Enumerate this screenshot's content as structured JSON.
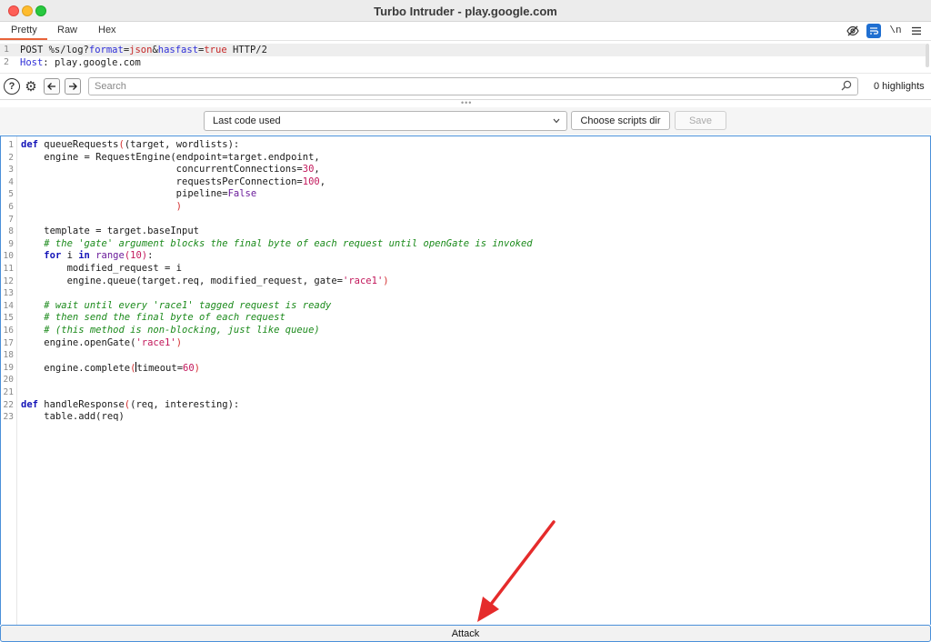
{
  "window": {
    "title": "Turbo Intruder - play.google.com"
  },
  "tabs": [
    {
      "label": "Pretty",
      "active": true
    },
    {
      "label": "Raw",
      "active": false
    },
    {
      "label": "Hex",
      "active": false
    }
  ],
  "toolbar_icons": {
    "hide": "eye-slash-icon",
    "wrap": "wrap-lines-icon",
    "newline_label": "\\n",
    "menu": "hamburger-menu-icon"
  },
  "request_preview": {
    "lines": [
      {
        "num": "1",
        "method": "POST ",
        "path": "%s/log?",
        "p1_key": "format",
        "p1_eq": "=",
        "p1_val": "json",
        "amp": "&",
        "p2_key": "hasfast",
        "p2_eq": "=",
        "p2_val": "true",
        "proto": " HTTP/2"
      },
      {
        "num": "2",
        "header_name": "Host",
        "header_sep": ": ",
        "header_val": "play.google.com"
      }
    ]
  },
  "search": {
    "placeholder": "Search",
    "value": "",
    "highlights": "0 highlights"
  },
  "script_controls": {
    "selected": "Last code used",
    "choose_dir_label": "Choose scripts dir",
    "save_label": "Save"
  },
  "code": {
    "lines": [
      {
        "num": "1"
      },
      {
        "num": "2"
      },
      {
        "num": "3"
      },
      {
        "num": "4"
      },
      {
        "num": "5"
      },
      {
        "num": "6"
      },
      {
        "num": "7"
      },
      {
        "num": "8"
      },
      {
        "num": "9"
      },
      {
        "num": "10"
      },
      {
        "num": "11"
      },
      {
        "num": "12"
      },
      {
        "num": "13"
      },
      {
        "num": "14"
      },
      {
        "num": "15"
      },
      {
        "num": "16"
      },
      {
        "num": "17"
      },
      {
        "num": "18"
      },
      {
        "num": "19"
      },
      {
        "num": "20"
      },
      {
        "num": "21"
      },
      {
        "num": "22"
      },
      {
        "num": "23"
      }
    ],
    "t": {
      "def": "def",
      "queueRequests": " queueRequests",
      "qr_args": "(target, wordlists):",
      "l2a": "    engine = RequestEngine",
      "l2b": "(endpoint=target.endpoint,",
      "l3a": "                           concurrentConnections=",
      "n30": "30",
      "comma": ",",
      "l4a": "                           requestsPerConnection=",
      "n100": "100",
      "l5a": "                           pipeline=",
      "false": "False",
      "l6": "                           )",
      "l8": "    template = target.baseInput",
      "l9": "    # the 'gate' argument blocks the final byte of each request until openGate is invoked",
      "indent4": "    ",
      "for": "for",
      "i_in": " i ",
      "in": "in",
      "sp": " ",
      "range": "range",
      "n10": "(10)",
      "colon": ":",
      "l11": "        modified_request = i",
      "l12a": "        engine.queue(target.req, modified_request, gate=",
      "race1_q": "'race1'",
      "close_paren": ")",
      "l14": "    # wait until every 'race1' tagged request is ready",
      "l15": "    # then send the final byte of each request",
      "l16": "    # (this method is non-blocking, just like queue)",
      "l17a": "    engine.openGate(",
      "l19a": "    engine.complete",
      "l19b": "timeout=",
      "n60": "60",
      "handleResponse": " handleResponse",
      "hr_args": "(req, interesting):",
      "l23": "    table.add(req)"
    }
  },
  "attack_label": "Attack",
  "colors": {
    "accent_orange": "#e8633a",
    "focus_blue": "#4a90d9",
    "arrow_red": "#e52b2b"
  }
}
